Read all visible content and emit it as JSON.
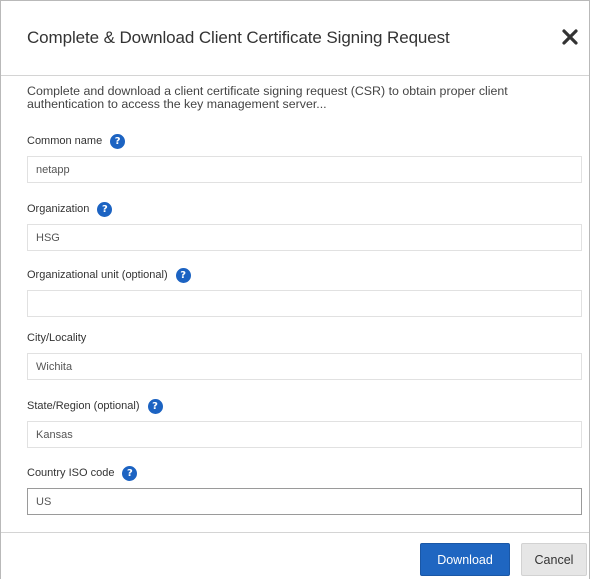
{
  "dialog": {
    "title": "Complete & Download Client Certificate Signing Request",
    "close_icon": "close-icon",
    "intro": "Complete and download a client certificate signing request (CSR) to obtain proper client authentication to access the key management server..."
  },
  "fields": {
    "common_name": {
      "label": "Common name",
      "value": "netapp",
      "help_icon": "help-icon"
    },
    "organization": {
      "label": "Organization",
      "value": "HSG",
      "help_icon": "help-icon"
    },
    "organizational_unit": {
      "label": "Organizational unit (optional)",
      "value": "",
      "help_icon": "help-icon"
    },
    "city_locality": {
      "label": "City/Locality",
      "value": "Wichita"
    },
    "state_region": {
      "label": "State/Region (optional)",
      "value": "Kansas",
      "help_icon": "help-icon"
    },
    "country_iso_code": {
      "label": "Country ISO code",
      "value": "US",
      "help_icon": "help-icon"
    }
  },
  "help_glyph": "?",
  "footer": {
    "download_label": "Download",
    "cancel_label": "Cancel"
  },
  "colors": {
    "primary_button": "#1f66c1",
    "help_icon": "#1c63c2",
    "cancel_button": "#e6e6e6"
  }
}
